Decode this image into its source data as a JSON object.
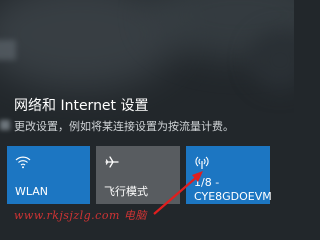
{
  "panel": {
    "title": "网络和 Internet 设置",
    "description": "更改设置，例如将某连接设置为按流量计费。"
  },
  "tiles": [
    {
      "label": "WLAN",
      "icon": "wifi-icon"
    },
    {
      "label": "飞行模式",
      "icon": "airplane-icon"
    },
    {
      "line1": "1/8 -",
      "line2": "CYE8GDOEVM",
      "icon": "cellular-signal-icon"
    }
  ],
  "watermark": {
    "text": "www.rkjsjzlg.com 电脑"
  },
  "colors": {
    "accent": "#1c76c2",
    "tile_off": "#585c60",
    "arrow": "#e01e1e"
  }
}
